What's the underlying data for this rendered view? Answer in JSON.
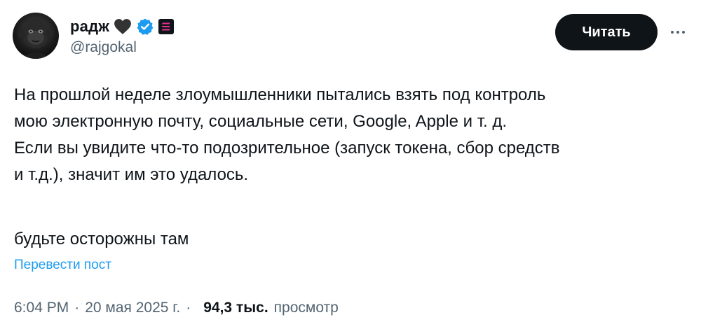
{
  "author": {
    "display_name": "радж",
    "handle": "@rajgokal",
    "heart_color": "#333333",
    "verified_color": "#1d9bf0",
    "badge_icon": "solana-icon"
  },
  "actions": {
    "follow_label": "Читать",
    "more_icon": "more-options-icon"
  },
  "tweet": {
    "lines": [
      "На прошлой неделе злоумышленники пытались взять под контроль",
      "мою электронную почту, социальные сети, Google, Apple и т. д.",
      "Если вы увидите что-то подозрительное (запуск токена, сбор средств",
      "и т.д.), значит им это удалось."
    ],
    "closing": "будьте осторожны там",
    "translate_label": "Перевести пост"
  },
  "meta": {
    "time": "6:04 PM",
    "separator": "·",
    "date": "20 мая 2025 г.",
    "views_count": "94,3 тыс.",
    "views_label": "просмотр"
  }
}
